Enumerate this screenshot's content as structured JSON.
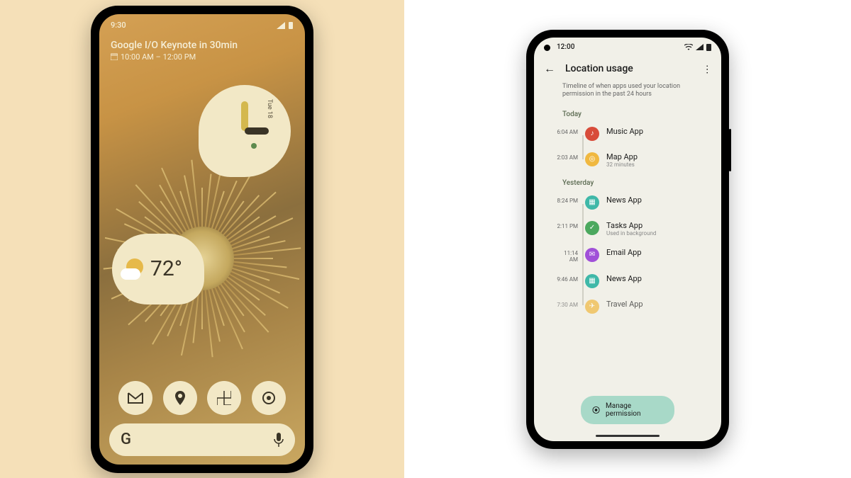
{
  "left_phone": {
    "status_time": "9:30",
    "event": {
      "title": "Google I/O Keynote in 30min",
      "time_range": "10:00 AM – 12:00 PM"
    },
    "clock_widget": {
      "date": "Tue 18"
    },
    "weather": {
      "temp": "72°"
    },
    "search": {
      "logo": "G"
    }
  },
  "right_phone": {
    "status_time": "12:00",
    "header": {
      "title": "Location usage"
    },
    "subtitle": "Timeline of when apps used your location permission in the past 24 hours",
    "sections": {
      "today_label": "Today",
      "yesterday_label": "Yesterday"
    },
    "today": [
      {
        "time": "6:04 AM",
        "name": "Music App",
        "sub": "",
        "color": "ic-red"
      },
      {
        "time": "2:03 AM",
        "name": "Map App",
        "sub": "32 minutes",
        "color": "ic-yellow"
      }
    ],
    "yesterday": [
      {
        "time": "8:24 PM",
        "name": "News App",
        "sub": "",
        "color": "ic-teal"
      },
      {
        "time": "2:11 PM",
        "name": "Tasks App",
        "sub": "Used in background",
        "color": "ic-green"
      },
      {
        "time": "11:14 AM",
        "name": "Email App",
        "sub": "",
        "color": "ic-purple"
      },
      {
        "time": "9:46 AM",
        "name": "News App",
        "sub": "",
        "color": "ic-teal"
      },
      {
        "time": "7:30 AM",
        "name": "Travel App",
        "sub": "",
        "color": "ic-yellow"
      }
    ],
    "manage_button": "Manage permission"
  }
}
